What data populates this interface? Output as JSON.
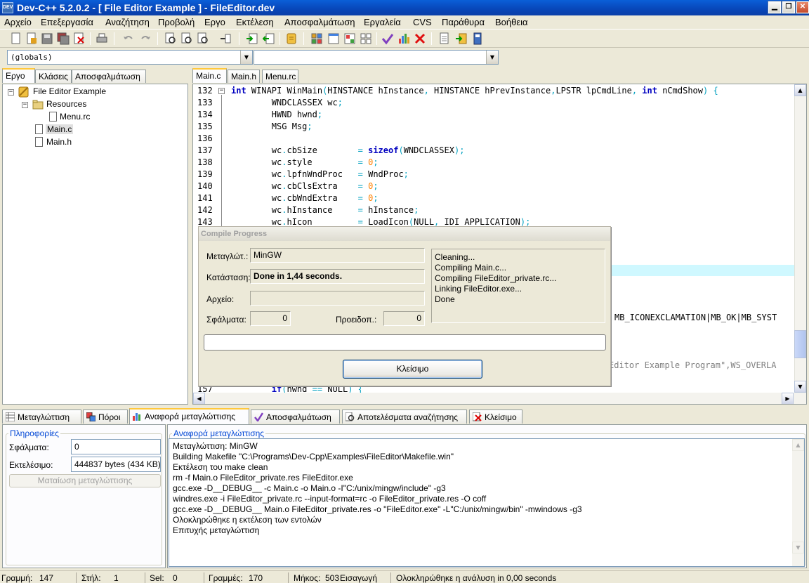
{
  "window": {
    "title": "Dev-C++ 5.2.0.2 - [ File Editor Example ] - FileEditor.dev",
    "icon_label": "DEV"
  },
  "menu": [
    "Αρχείο",
    "Επεξεργασία",
    "Αναζήτηση",
    "Προβολή",
    "Εργο",
    "Εκτέλεση",
    "Αποσφαλμάτωση",
    "Εργαλεία",
    "CVS",
    "Παράθυρα",
    "Βοήθεια"
  ],
  "combos": {
    "scope": "(globals)",
    "symbol": ""
  },
  "left_tabs": [
    "Εργο",
    "Κλάσεις",
    "Αποσφαλμάτωση"
  ],
  "tree": {
    "project": "File Editor Example",
    "folder": "Resources",
    "files": [
      "Menu.rc",
      "Main.c",
      "Main.h"
    ]
  },
  "editor_tabs": [
    "Main.c",
    "Main.h",
    "Menu.rc"
  ],
  "code": {
    "line_numbers": [
      "132",
      "133",
      "134",
      "135",
      "136",
      "137",
      "138",
      "139",
      "140",
      "141",
      "142",
      "143",
      "157"
    ],
    "lines": [
      "int WINAPI WinMain(HINSTANCE hInstance, HINSTANCE hPrevInstance,LPSTR lpCmdLine, int nCmdShow) {",
      "        WNDCLASSEX wc;",
      "        HWND hwnd;",
      "        MSG Msg;",
      "",
      "        wc.cbSize        = sizeof(WNDCLASSEX);",
      "        wc.style         = 0;",
      "        wc.lpfnWndProc   = WndProc;",
      "        wc.cbClsExtra    = 0;",
      "        wc.cbWndExtra    = 0;",
      "        wc.hInstance     = hInstance;",
      "        wc.hIcon         = LoadIcon(NULL, IDI_APPLICATION);",
      "        if(hwnd == NULL) {"
    ],
    "fragment_1": "MB_ICONEXCLAMATION|MB_OK|MB_SYST",
    "fragment_2": "Editor Example Program\",WS_OVERLA"
  },
  "dialog": {
    "title": "Compile Progress",
    "compiler_label": "Μεταγλώτ.:",
    "compiler_value": "MinGW",
    "status_label": "Κατάσταση:",
    "status_value": "Done in 1,44 seconds.",
    "file_label": "Αρχείο:",
    "file_value": "",
    "errors_label": "Σφάλματα:",
    "errors_value": "0",
    "warnings_label": "Προειδοπ.:",
    "warnings_value": "0",
    "log": [
      "Cleaning...",
      "Compiling Main.c...",
      "Compiling FileEditor_private.rc...",
      "Linking FileEditor.exe...",
      "Done"
    ],
    "progress": 0,
    "close_label": "Κλείσιμο"
  },
  "bottom_tabs": [
    "Μεταγλώττιση",
    "Πόροι",
    "Αναφορά μεταγλώττισης",
    "Αποσφαλμάτωση",
    "Αποτελέσματα αναζήτησης",
    "Κλείσιμο"
  ],
  "info": {
    "group_label": "Πληροφορίες",
    "errors_label": "Σφάλματα:",
    "errors_value": "0",
    "exe_label": "Εκτελέσιμο:",
    "exe_value": "444837 bytes (434 KB)",
    "abort_label": "Ματαίωση μεταγλώττισης"
  },
  "report": {
    "label": "Αναφορά μεταγλώττισης",
    "lines": [
      "Μεταγλώττιση: MinGW",
      "Building Makefile \"C:\\Programs\\Dev-Cpp\\Examples\\FileEditor\\Makefile.win\"",
      "Εκτέλεση του  make clean",
      "rm -f Main.o FileEditor_private.res FileEditor.exe",
      "gcc.exe -D__DEBUG__ -c Main.c -o Main.o -I\"C:/unix/mingw/include\"    -g3",
      "windres.exe -i FileEditor_private.rc --input-format=rc -o FileEditor_private.res -O coff",
      "gcc.exe -D__DEBUG__ Main.o FileEditor_private.res -o \"FileEditor.exe\" -L\"C:/unix/mingw/bin\" -mwindows  -g3",
      "Ολοκληρώθηκε η εκτέλεση των εντολών",
      "Επιτυχής μεταγλώττιση"
    ]
  },
  "status": {
    "line_label": "Γραμμή:",
    "line_value": "147",
    "col_label": "Στήλ:",
    "col_value": "1",
    "sel_label": "Sel:",
    "sel_value": "0",
    "lines_label": "Γραμμές:",
    "lines_value": "170",
    "length_label": "Μήκος:",
    "length_value": "503",
    "mode": "Εισαγωγή",
    "message": "Ολοκληρώθηκε η ανάλυση in 0,00 seconds"
  }
}
